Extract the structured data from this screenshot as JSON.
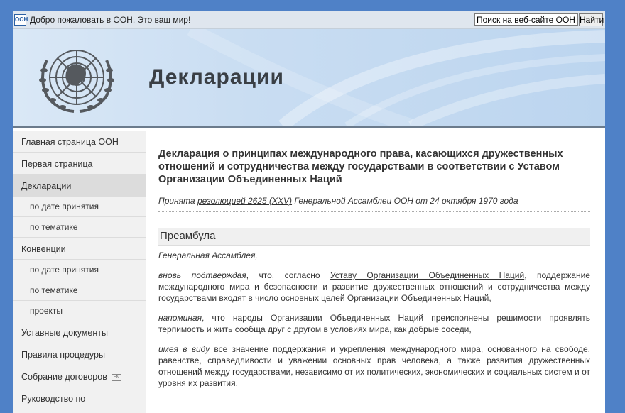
{
  "topbar": {
    "logo_mini": "ООН",
    "welcome": "Добро пожаловать в ООН. Это ваш мир!",
    "search_value": "Поиск на веб-сайте ООН",
    "search_button": "Найти"
  },
  "banner": {
    "title": "Декларации"
  },
  "sidebar": {
    "items": [
      {
        "label": "Главная страница ООН",
        "level": "top"
      },
      {
        "label": "Первая страница",
        "level": "top"
      },
      {
        "label": "Декларации",
        "level": "top",
        "active": true
      },
      {
        "label": "по дате принятия",
        "level": "sub"
      },
      {
        "label": "по тематике",
        "level": "sub"
      },
      {
        "label": "Конвенции",
        "level": "top"
      },
      {
        "label": "по дате принятия",
        "level": "sub"
      },
      {
        "label": "по тематике",
        "level": "sub"
      },
      {
        "label": "проекты",
        "level": "sub"
      },
      {
        "label": "Уставные документы",
        "level": "top"
      },
      {
        "label": "Правила процедуры",
        "level": "top"
      },
      {
        "label": "Собрание договоров",
        "level": "top",
        "badge": "EN"
      },
      {
        "label": "Руководство по",
        "level": "top"
      }
    ]
  },
  "content": {
    "title": "Декларация о принципах международного права, касающихся дружественных отношений и сотрудничества между государствами в соответствии с Уставом Организации Объединенных Наций",
    "adopted_prefix": "Принята ",
    "adopted_link": "резолюцией 2625 (XXV)",
    "adopted_suffix": " Генеральной Ассамблеи ООН от 24 октября 1970 года",
    "section": "Преамбула",
    "p1": "Генеральная Ассамблея,",
    "p2_lead": "вновь подтверждая",
    "p2_a": ", что, согласно ",
    "p2_link": "Уставу Организации Объединенных Наций",
    "p2_b": ", поддержание международного мира и безопасности и развитие дружественных отношений и сотрудничества между государствами входят в число основных целей Организации Объединенных Наций,",
    "p3_lead": "напоминая",
    "p3_text": ", что народы Организации Объединенных Наций преисполнены решимости проявлять терпимость и жить сообща друг с другом в условиях мира, как добрые соседи,",
    "p4_lead": "имея в виду",
    "p4_text": " все значение поддержания и укрепления международного мира, основанного на свободе, равенстве, справедливости и уважении основных прав человека, а также развития дружественных отношений между государствами, независимо от их политических, экономических и социальных систем и от уровня их развития,"
  }
}
